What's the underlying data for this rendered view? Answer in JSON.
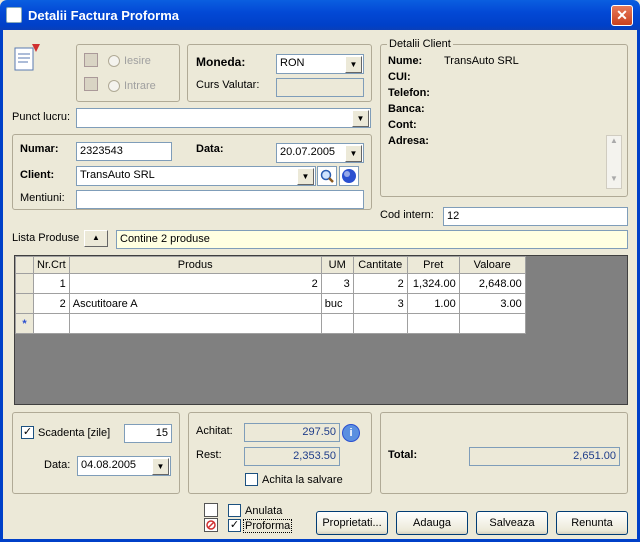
{
  "window": {
    "title": "Detalii Factura Proforma",
    "close": "✕"
  },
  "direction": {
    "iesire": "Iesire",
    "intrare": "Intrare"
  },
  "currency": {
    "label": "Moneda:",
    "value": "RON",
    "rate_label": "Curs Valutar:",
    "rate_value": ""
  },
  "client_details": {
    "legend": "Detalii Client",
    "nume_label": "Nume:",
    "nume_value": "TransAuto SRL",
    "cui_label": "CUI:",
    "telefon_label": "Telefon:",
    "banca_label": "Banca:",
    "cont_label": "Cont:",
    "adresa_label": "Adresa:"
  },
  "punct_lucru": {
    "label": "Punct lucru:",
    "value": ""
  },
  "invoice": {
    "numar_label": "Numar:",
    "numar_value": "2323543",
    "data_label": "Data:",
    "data_value": "20.07.2005",
    "client_label": "Client:",
    "client_value": "TransAuto SRL",
    "mentiuni_label": "Mentiuni:",
    "mentiuni_value": ""
  },
  "cod_intern": {
    "label": "Cod intern:",
    "value": "12"
  },
  "products": {
    "label": "Lista Produse",
    "summary": "Contine 2 produse",
    "columns": [
      "Nr.Crt",
      "Produs",
      "UM",
      "Cantitate",
      "Pret",
      "Valoare"
    ],
    "rows": [
      {
        "nr": "1",
        "produs": "2",
        "um": "3",
        "cantitate": "2",
        "pret": "1,324.00",
        "valoare": "2,648.00"
      },
      {
        "nr": "2",
        "produs": "Ascutitoare A",
        "um": "buc",
        "cantitate": "3",
        "pret": "1.00",
        "valoare": "3.00"
      }
    ],
    "new_row_marker": "*"
  },
  "due": {
    "checkbox_label": "Scadenta [zile]",
    "checked": "✓",
    "days": "15",
    "date_label": "Data:",
    "date_value": "04.08.2005"
  },
  "payment": {
    "achitat_label": "Achitat:",
    "achitat_value": "297.50",
    "rest_label": "Rest:",
    "rest_value": "2,353.50",
    "save_pay_label": "Achita la salvare"
  },
  "total": {
    "label": "Total:",
    "value": "2,651.00"
  },
  "flags": {
    "anulata_label": "Anulata",
    "proforma_label": "Proforma",
    "proforma_checked": "✓"
  },
  "buttons": {
    "proprietati": "Proprietati...",
    "adauga": "Adauga",
    "salveaza": "Salveaza",
    "renunta": "Renunta"
  },
  "colors": {
    "title_bar": "#0349d6",
    "window_bg": "#ece9d8",
    "readonly_value": "#1f3d8a",
    "grid_bg": "#808080",
    "summary_bg": "#ffffe1"
  }
}
